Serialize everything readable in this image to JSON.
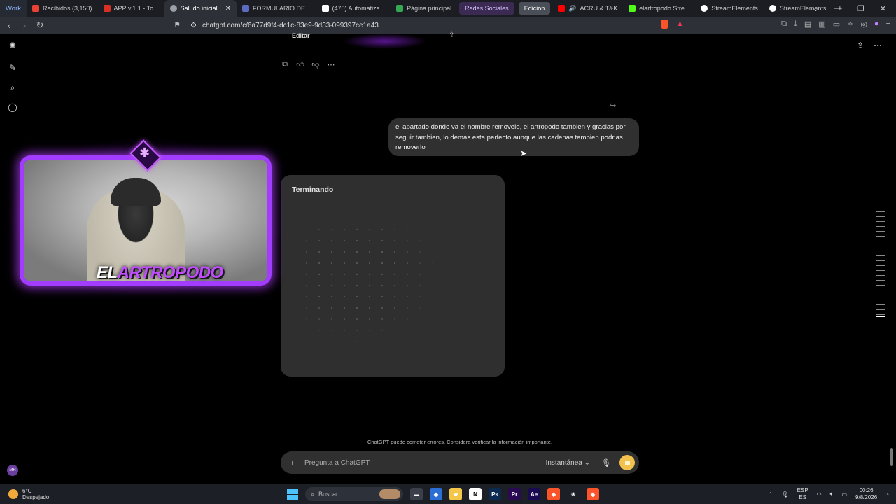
{
  "browser": {
    "work_label": "Work",
    "tabs": [
      {
        "label": "Recibidos (3,150)",
        "color": "#ea4335"
      },
      {
        "label": "APP v.1.1 - To...",
        "color": "#d93025"
      },
      {
        "label": "Saludo inicial",
        "color": "#9aa0a6"
      },
      {
        "label": "FORMULARIO DE...",
        "color": "#5c6bc0"
      },
      {
        "label": "(470) Automatiza...",
        "color": "#ffffff"
      },
      {
        "label": "Página principal",
        "color": "#34a853"
      }
    ],
    "groups": [
      "Redes Sociales",
      "Edicion"
    ],
    "tabs_right": [
      {
        "label": "ACRU & T&K",
        "color": "#ff0000"
      },
      {
        "label": "elartropodo Stre...",
        "color": "#53fc18"
      },
      {
        "label": "StreamElements",
        "color": "#ffffff"
      },
      {
        "label": "StreamElements",
        "color": "#ffffff"
      }
    ],
    "url": "chatgpt.com/c/6a77d9f4-dc1c-83e9-9d33-099397ce1a43"
  },
  "chat": {
    "editar_label": "Editar",
    "user_message": "el apartado donde va el nombre removelo, el artropodo tambien y gracias por seguir tambien, lo demas esta perfecto aunque las cadenas tambien podrias removerlo",
    "thinking_label": "Terminando",
    "disclaimer": "ChatGPT puede cometer errores. Considera verificar la información importante.",
    "composer_placeholder": "Pregunta a ChatGPT",
    "mode_label": "Instantánea"
  },
  "overlay": {
    "name_part1": "EL",
    "name_part2": "ARTROPODO"
  },
  "sidebar": {
    "avatar_initials": "MR"
  },
  "taskbar": {
    "temperature": "6°C",
    "weather": "Despejado",
    "search_label": "Buscar",
    "lang_top": "ESP",
    "lang_bottom": "ES",
    "time": "00:26",
    "date": "9/8/2026",
    "apps": [
      {
        "name": "file-explorer-icon",
        "glyph": "▬",
        "bg": "#3a3f4a"
      },
      {
        "name": "copilot-icon",
        "glyph": "◆",
        "bg": "#2b6fd6"
      },
      {
        "name": "folder-icon",
        "glyph": "▰",
        "bg": "#f4c64a"
      },
      {
        "name": "notion-icon",
        "glyph": "N",
        "bg": "#ffffff"
      },
      {
        "name": "photoshop-icon",
        "glyph": "Ps",
        "bg": "#0a2a52"
      },
      {
        "name": "premiere-icon",
        "glyph": "Pr",
        "bg": "#2a0a52"
      },
      {
        "name": "after-effects-icon",
        "glyph": "Ae",
        "bg": "#1a0a52"
      },
      {
        "name": "brave-icon",
        "glyph": "◈",
        "bg": "#fb542b"
      },
      {
        "name": "claude-icon",
        "glyph": "✳",
        "bg": "#1c1f26"
      },
      {
        "name": "brave-active-icon",
        "glyph": "◈",
        "bg": "#fb542b"
      }
    ]
  }
}
